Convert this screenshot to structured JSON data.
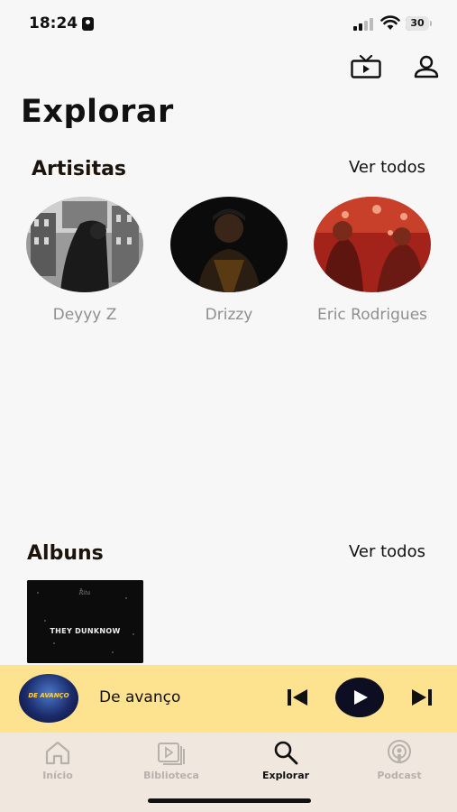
{
  "status_bar": {
    "time": "18:24",
    "battery": "30"
  },
  "header": {
    "title": "Explorar"
  },
  "artists_section": {
    "title": "Artisitas",
    "see_all": "Ver todos",
    "items": [
      {
        "name": "Deyyy Z"
      },
      {
        "name": "Drizzy"
      },
      {
        "name": "Eric Rodrigues"
      }
    ]
  },
  "albums_section": {
    "title": "Albuns",
    "see_all": "Ver todos",
    "items": [
      {
        "cover_text": "THEY DUNKNOW"
      }
    ]
  },
  "player": {
    "track_title": "De avanço",
    "art_text": "DE AVANÇO"
  },
  "tabs": [
    {
      "label": "Início",
      "icon": "home-icon"
    },
    {
      "label": "Biblioteca",
      "icon": "library-icon"
    },
    {
      "label": "Explorar",
      "icon": "search-icon"
    },
    {
      "label": "Podcast",
      "icon": "podcast-icon"
    }
  ],
  "colors": {
    "player_bg": "#fde28f",
    "tabbar_bg": "#f0e7df",
    "active_tab": "#111111",
    "inactive_tab": "#b8b0aa"
  }
}
